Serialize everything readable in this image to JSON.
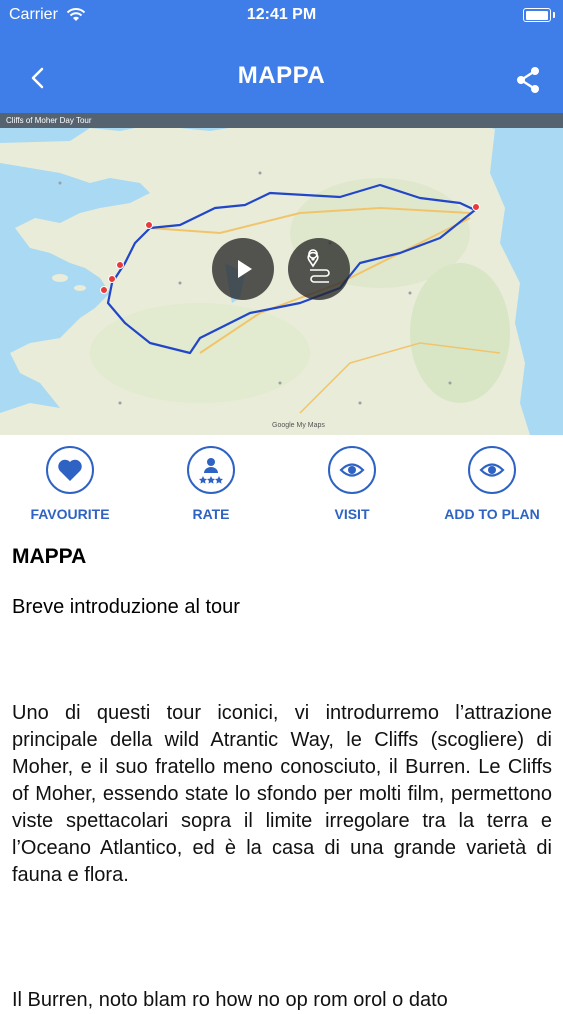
{
  "status_bar": {
    "carrier": "Carrier",
    "time": "12:41 PM"
  },
  "header": {
    "title": "MAPPA",
    "back_icon": "chevron-left-icon",
    "share_icon": "share-icon",
    "background_color": "#3f7ee8"
  },
  "map": {
    "title": "Cliffs of Moher Day Tour",
    "watermark": "Google My Maps",
    "play_icon": "play-icon",
    "location_icon": "map-pin-icon"
  },
  "actions": [
    {
      "label": "FAVOURITE",
      "icon": "heart-icon"
    },
    {
      "label": "RATE",
      "icon": "user-rating-icon"
    },
    {
      "label": "VISIT",
      "icon": "eye-icon"
    },
    {
      "label": "ADD TO PLAN",
      "icon": "eye-icon"
    }
  ],
  "content": {
    "title": "MAPPA",
    "intro": "Breve introduzione al tour",
    "paragraph": "Uno di questi tour iconici, vi introdurremo l’attrazione principale della wild Atrantic Way, le Cliffs (scogliere) di Moher, e il suo fratello meno conosciuto, il Burren. Le Cliffs of Moher, essendo state lo sfondo per molti film, permettono viste spettacolari sopra il limite irregolare tra la terra e l’Oceano Atlantico, ed è la casa di una grande varietà di fauna e flora.",
    "paragraph_next": "Il Burren, noto blam ro how no op rom orol o dato"
  },
  "accent_color": "#2e63c4"
}
